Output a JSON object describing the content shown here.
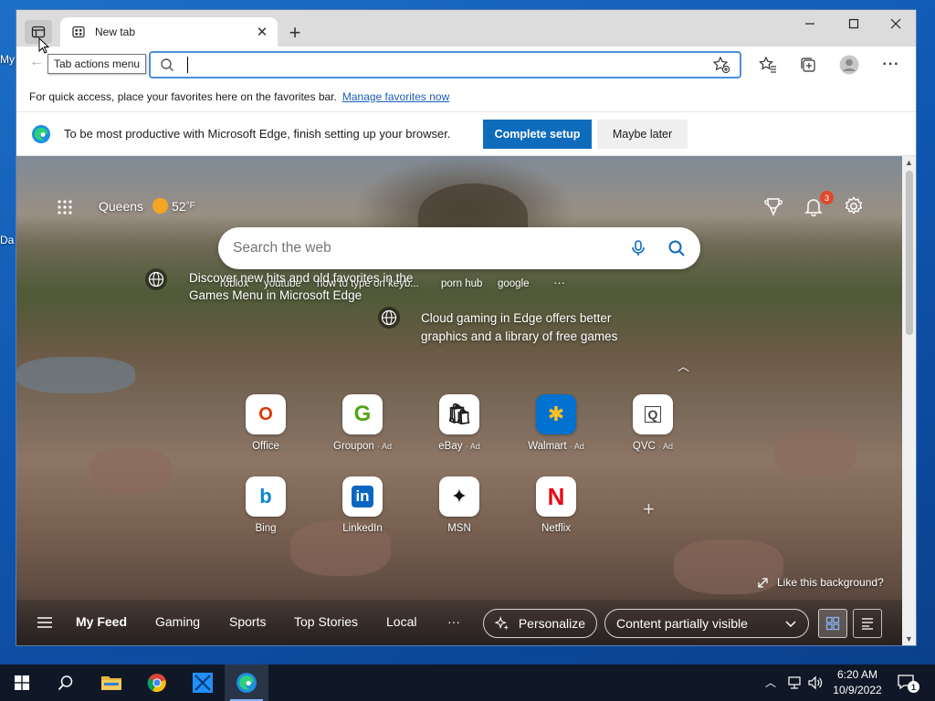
{
  "desktop": {
    "fragments": [
      "My",
      "Da"
    ]
  },
  "window": {
    "tab": {
      "title": "New tab"
    },
    "tooltip": "Tab actions menu",
    "address": {
      "value": "",
      "placeholder": ""
    },
    "favorites_bar": {
      "text": "For quick access, place your favorites here on the favorites bar.",
      "link": "Manage favorites now"
    },
    "setup_bar": {
      "text": "To be most productive with Microsoft Edge, finish setting up your browser.",
      "primary": "Complete setup",
      "secondary": "Maybe later"
    }
  },
  "ntp": {
    "weather": {
      "location": "Queens",
      "temp": "52",
      "unit": "°F"
    },
    "notification_count": "3",
    "search": {
      "placeholder": "Search the web"
    },
    "suggestions": [
      "roblox",
      "youtube",
      "how to type on keyb...",
      "porn hub",
      "google"
    ],
    "promos": [
      {
        "text": "Discover new hits and old favorites in the Games Menu in Microsoft Edge"
      },
      {
        "text": "Cloud gaming in Edge offers better graphics and a library of free games"
      }
    ],
    "tiles": [
      {
        "label": "Office",
        "ad": "",
        "glyph": "O",
        "color": "#d83b01"
      },
      {
        "label": "Groupon",
        "ad": "· Ad",
        "glyph": "G",
        "color": "#53a318"
      },
      {
        "label": "eBay",
        "ad": "· Ad",
        "glyph": "🛍",
        "color": "#e53238"
      },
      {
        "label": "Walmart",
        "ad": "· Ad",
        "glyph": "✱",
        "color": "#ffc220"
      },
      {
        "label": "QVC",
        "ad": "· Ad",
        "glyph": "Q",
        "color": "#444444"
      },
      {
        "label": "Bing",
        "ad": "",
        "glyph": "b",
        "color": "#0a84d6"
      },
      {
        "label": "LinkedIn",
        "ad": "",
        "glyph": "in",
        "color": "#0a66c2"
      },
      {
        "label": "MSN",
        "ad": "",
        "glyph": "✦",
        "color": "#111111"
      },
      {
        "label": "Netflix",
        "ad": "",
        "glyph": "N",
        "color": "#e50914"
      }
    ],
    "like_background": "Like this background?",
    "feed": {
      "tabs": [
        "My Feed",
        "Gaming",
        "Sports",
        "Top Stories",
        "Local"
      ],
      "more": "···",
      "personalize": "Personalize",
      "content_select": "Content partially visible"
    }
  },
  "taskbar": {
    "time": "6:20 AM",
    "date": "10/9/2022",
    "notification_count": "1"
  }
}
